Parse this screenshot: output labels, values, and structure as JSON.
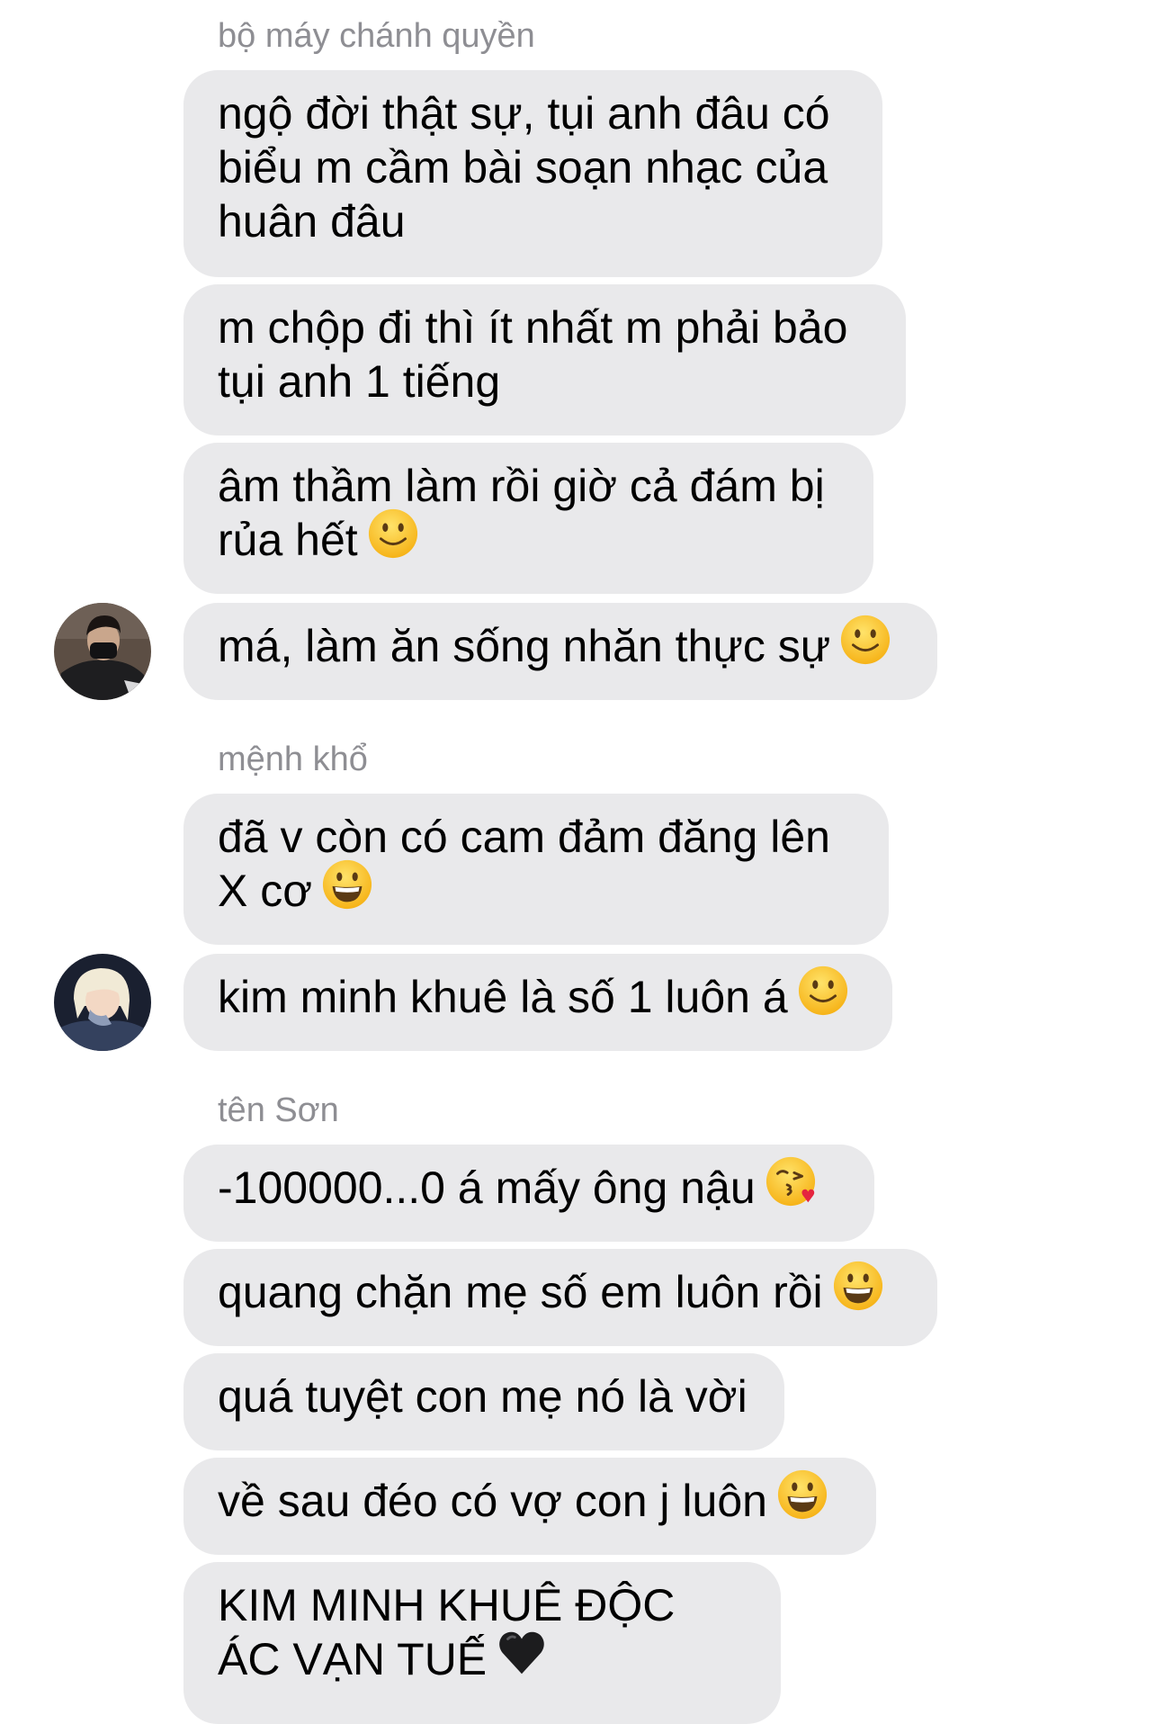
{
  "messages": [
    {
      "sender": "bộ máy chánh quyền"
    },
    {
      "text": "ngộ đời thật sự, tụi anh đâu có biểu m cầm bài soạn nhạc của huân đâu"
    },
    {
      "text": "m chộp đi thì ít nhất m phải bảo tụi anh 1 tiếng"
    },
    {
      "text": "âm thầm làm rồi giờ cả đám bị rủa hết",
      "emoji": "slightly-smiling-face"
    },
    {
      "text": "má, làm ăn sống nhăn thực sự",
      "emoji": "slightly-smiling-face",
      "avatar": "avatar-masked-man"
    },
    {
      "sender": "mệnh khổ"
    },
    {
      "text": "đã v còn có cam đảm đăng lên X cơ",
      "emoji": "grinning-face"
    },
    {
      "text": "kim minh khuê là số 1 luôn á",
      "emoji": "slightly-smiling-face",
      "avatar": "avatar-blonde-person"
    },
    {
      "sender": "tên Sơn"
    },
    {
      "text": "-100000...0 á mấy ông nậu",
      "emoji": "face-blowing-kiss"
    },
    {
      "text": "quang chặn mẹ số em luôn rồi",
      "emoji": "grinning-face"
    },
    {
      "text": "quá tuyệt con mẹ nó là vời"
    },
    {
      "text": "về sau đéo có vợ con j luôn",
      "emoji": "grinning-face"
    },
    {
      "text": "KIM MINH KHUÊ ĐỘC ÁC VẠN TUẾ",
      "emoji": "black-heart"
    }
  ]
}
